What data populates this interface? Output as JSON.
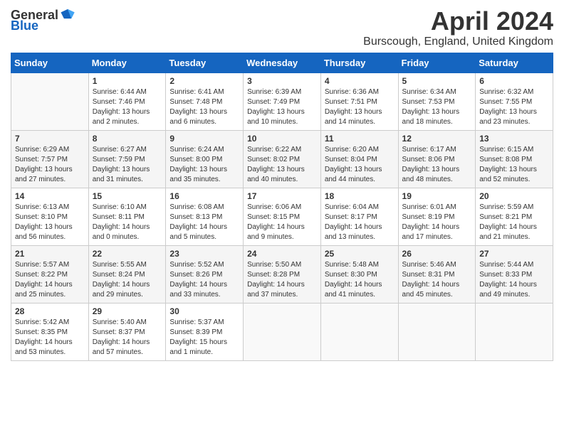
{
  "header": {
    "logo_general": "General",
    "logo_blue": "Blue",
    "month_title": "April 2024",
    "location": "Burscough, England, United Kingdom"
  },
  "days_of_week": [
    "Sunday",
    "Monday",
    "Tuesday",
    "Wednesday",
    "Thursday",
    "Friday",
    "Saturday"
  ],
  "weeks": [
    [
      {
        "day": "",
        "sunrise": "",
        "sunset": "",
        "daylight": ""
      },
      {
        "day": "1",
        "sunrise": "Sunrise: 6:44 AM",
        "sunset": "Sunset: 7:46 PM",
        "daylight": "Daylight: 13 hours and 2 minutes."
      },
      {
        "day": "2",
        "sunrise": "Sunrise: 6:41 AM",
        "sunset": "Sunset: 7:48 PM",
        "daylight": "Daylight: 13 hours and 6 minutes."
      },
      {
        "day": "3",
        "sunrise": "Sunrise: 6:39 AM",
        "sunset": "Sunset: 7:49 PM",
        "daylight": "Daylight: 13 hours and 10 minutes."
      },
      {
        "day": "4",
        "sunrise": "Sunrise: 6:36 AM",
        "sunset": "Sunset: 7:51 PM",
        "daylight": "Daylight: 13 hours and 14 minutes."
      },
      {
        "day": "5",
        "sunrise": "Sunrise: 6:34 AM",
        "sunset": "Sunset: 7:53 PM",
        "daylight": "Daylight: 13 hours and 18 minutes."
      },
      {
        "day": "6",
        "sunrise": "Sunrise: 6:32 AM",
        "sunset": "Sunset: 7:55 PM",
        "daylight": "Daylight: 13 hours and 23 minutes."
      }
    ],
    [
      {
        "day": "7",
        "sunrise": "Sunrise: 6:29 AM",
        "sunset": "Sunset: 7:57 PM",
        "daylight": "Daylight: 13 hours and 27 minutes."
      },
      {
        "day": "8",
        "sunrise": "Sunrise: 6:27 AM",
        "sunset": "Sunset: 7:59 PM",
        "daylight": "Daylight: 13 hours and 31 minutes."
      },
      {
        "day": "9",
        "sunrise": "Sunrise: 6:24 AM",
        "sunset": "Sunset: 8:00 PM",
        "daylight": "Daylight: 13 hours and 35 minutes."
      },
      {
        "day": "10",
        "sunrise": "Sunrise: 6:22 AM",
        "sunset": "Sunset: 8:02 PM",
        "daylight": "Daylight: 13 hours and 40 minutes."
      },
      {
        "day": "11",
        "sunrise": "Sunrise: 6:20 AM",
        "sunset": "Sunset: 8:04 PM",
        "daylight": "Daylight: 13 hours and 44 minutes."
      },
      {
        "day": "12",
        "sunrise": "Sunrise: 6:17 AM",
        "sunset": "Sunset: 8:06 PM",
        "daylight": "Daylight: 13 hours and 48 minutes."
      },
      {
        "day": "13",
        "sunrise": "Sunrise: 6:15 AM",
        "sunset": "Sunset: 8:08 PM",
        "daylight": "Daylight: 13 hours and 52 minutes."
      }
    ],
    [
      {
        "day": "14",
        "sunrise": "Sunrise: 6:13 AM",
        "sunset": "Sunset: 8:10 PM",
        "daylight": "Daylight: 13 hours and 56 minutes."
      },
      {
        "day": "15",
        "sunrise": "Sunrise: 6:10 AM",
        "sunset": "Sunset: 8:11 PM",
        "daylight": "Daylight: 14 hours and 0 minutes."
      },
      {
        "day": "16",
        "sunrise": "Sunrise: 6:08 AM",
        "sunset": "Sunset: 8:13 PM",
        "daylight": "Daylight: 14 hours and 5 minutes."
      },
      {
        "day": "17",
        "sunrise": "Sunrise: 6:06 AM",
        "sunset": "Sunset: 8:15 PM",
        "daylight": "Daylight: 14 hours and 9 minutes."
      },
      {
        "day": "18",
        "sunrise": "Sunrise: 6:04 AM",
        "sunset": "Sunset: 8:17 PM",
        "daylight": "Daylight: 14 hours and 13 minutes."
      },
      {
        "day": "19",
        "sunrise": "Sunrise: 6:01 AM",
        "sunset": "Sunset: 8:19 PM",
        "daylight": "Daylight: 14 hours and 17 minutes."
      },
      {
        "day": "20",
        "sunrise": "Sunrise: 5:59 AM",
        "sunset": "Sunset: 8:21 PM",
        "daylight": "Daylight: 14 hours and 21 minutes."
      }
    ],
    [
      {
        "day": "21",
        "sunrise": "Sunrise: 5:57 AM",
        "sunset": "Sunset: 8:22 PM",
        "daylight": "Daylight: 14 hours and 25 minutes."
      },
      {
        "day": "22",
        "sunrise": "Sunrise: 5:55 AM",
        "sunset": "Sunset: 8:24 PM",
        "daylight": "Daylight: 14 hours and 29 minutes."
      },
      {
        "day": "23",
        "sunrise": "Sunrise: 5:52 AM",
        "sunset": "Sunset: 8:26 PM",
        "daylight": "Daylight: 14 hours and 33 minutes."
      },
      {
        "day": "24",
        "sunrise": "Sunrise: 5:50 AM",
        "sunset": "Sunset: 8:28 PM",
        "daylight": "Daylight: 14 hours and 37 minutes."
      },
      {
        "day": "25",
        "sunrise": "Sunrise: 5:48 AM",
        "sunset": "Sunset: 8:30 PM",
        "daylight": "Daylight: 14 hours and 41 minutes."
      },
      {
        "day": "26",
        "sunrise": "Sunrise: 5:46 AM",
        "sunset": "Sunset: 8:31 PM",
        "daylight": "Daylight: 14 hours and 45 minutes."
      },
      {
        "day": "27",
        "sunrise": "Sunrise: 5:44 AM",
        "sunset": "Sunset: 8:33 PM",
        "daylight": "Daylight: 14 hours and 49 minutes."
      }
    ],
    [
      {
        "day": "28",
        "sunrise": "Sunrise: 5:42 AM",
        "sunset": "Sunset: 8:35 PM",
        "daylight": "Daylight: 14 hours and 53 minutes."
      },
      {
        "day": "29",
        "sunrise": "Sunrise: 5:40 AM",
        "sunset": "Sunset: 8:37 PM",
        "daylight": "Daylight: 14 hours and 57 minutes."
      },
      {
        "day": "30",
        "sunrise": "Sunrise: 5:37 AM",
        "sunset": "Sunset: 8:39 PM",
        "daylight": "Daylight: 15 hours and 1 minute."
      },
      {
        "day": "",
        "sunrise": "",
        "sunset": "",
        "daylight": ""
      },
      {
        "day": "",
        "sunrise": "",
        "sunset": "",
        "daylight": ""
      },
      {
        "day": "",
        "sunrise": "",
        "sunset": "",
        "daylight": ""
      },
      {
        "day": "",
        "sunrise": "",
        "sunset": "",
        "daylight": ""
      }
    ]
  ]
}
